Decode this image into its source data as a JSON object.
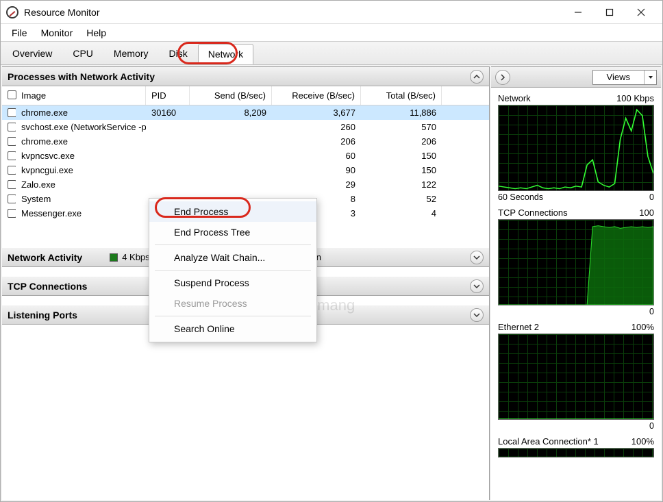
{
  "window": {
    "title": "Resource Monitor"
  },
  "menu": [
    "File",
    "Monitor",
    "Help"
  ],
  "tabs": {
    "items": [
      "Overview",
      "CPU",
      "Memory",
      "Disk",
      "Network"
    ],
    "active_index": 4
  },
  "processes_section": {
    "title": "Processes with Network Activity",
    "columns": [
      "Image",
      "PID",
      "Send (B/sec)",
      "Receive (B/sec)",
      "Total (B/sec)"
    ],
    "rows": [
      {
        "image": "chrome.exe",
        "pid": "30160",
        "send": "8,209",
        "recv": "3,677",
        "total": "11,886",
        "selected": true
      },
      {
        "image": "svchost.exe (NetworkService -p",
        "pid": "",
        "send": "",
        "recv": "260",
        "total": "570",
        "selected": false
      },
      {
        "image": "chrome.exe",
        "pid": "",
        "send": "",
        "recv": "206",
        "total": "206",
        "selected": false
      },
      {
        "image": "kvpncsvc.exe",
        "pid": "",
        "send": "",
        "recv": "60",
        "total": "150",
        "selected": false
      },
      {
        "image": "kvpncgui.exe",
        "pid": "",
        "send": "",
        "recv": "90",
        "total": "150",
        "selected": false
      },
      {
        "image": "Zalo.exe",
        "pid": "",
        "send": "",
        "recv": "29",
        "total": "122",
        "selected": false
      },
      {
        "image": "System",
        "pid": "",
        "send": "",
        "recv": "8",
        "total": "52",
        "selected": false
      },
      {
        "image": "Messenger.exe",
        "pid": "",
        "send": "",
        "recv": "3",
        "total": "4",
        "selected": false
      }
    ]
  },
  "context_menu": {
    "items": [
      {
        "label": "End Process",
        "kind": "item",
        "highlighted": true
      },
      {
        "label": "End Process Tree",
        "kind": "item"
      },
      {
        "kind": "sep"
      },
      {
        "label": "Analyze Wait Chain...",
        "kind": "item"
      },
      {
        "kind": "sep"
      },
      {
        "label": "Suspend Process",
        "kind": "item"
      },
      {
        "label": "Resume Process",
        "kind": "item",
        "disabled": true
      },
      {
        "kind": "sep"
      },
      {
        "label": "Search Online",
        "kind": "item"
      }
    ]
  },
  "collapsed_sections": [
    {
      "title": "Network Activity",
      "chip1_color": "#1c7a1c",
      "chip1_text": "4 Kbps Network I/O",
      "chip2_color": "#2a2aa8",
      "chip2_text": "0% Network Utilization"
    },
    {
      "title": "TCP Connections"
    },
    {
      "title": "Listening Ports"
    }
  ],
  "right_panel": {
    "views_label": "Views",
    "charts": [
      {
        "title": "Network",
        "scale": "100 Kbps",
        "footer_left": "60 Seconds",
        "footer_right": "0",
        "style": "spiky"
      },
      {
        "title": "TCP Connections",
        "scale": "100",
        "footer_left": "",
        "footer_right": "0",
        "style": "plateau"
      },
      {
        "title": "Ethernet 2",
        "scale": "100%",
        "footer_left": "",
        "footer_right": "0",
        "style": "flat"
      },
      {
        "title": "Local Area Connection* 1",
        "scale": "100%",
        "footer_left": "",
        "footer_right": "",
        "style": "flat-partial"
      }
    ]
  },
  "watermark": "Quantrimang",
  "chart_data": [
    {
      "type": "line",
      "title": "Network",
      "ylabel": "Kbps",
      "ylim": [
        0,
        100
      ],
      "xlabel": "60 Seconds",
      "x_range_seconds": 60,
      "values": [
        5,
        4,
        3,
        2,
        3,
        2,
        4,
        6,
        3,
        2,
        3,
        2,
        4,
        3,
        5,
        4,
        30,
        36,
        10,
        6,
        4,
        8,
        60,
        85,
        70,
        95,
        88,
        40,
        20
      ]
    },
    {
      "type": "area",
      "title": "TCP Connections",
      "ylim": [
        0,
        100
      ],
      "x_range_seconds": 60,
      "values": [
        0,
        0,
        0,
        0,
        0,
        0,
        0,
        0,
        0,
        0,
        0,
        0,
        0,
        0,
        0,
        0,
        0,
        92,
        93,
        92,
        91,
        92,
        90,
        91,
        92,
        91,
        92,
        91,
        92
      ]
    },
    {
      "type": "line",
      "title": "Ethernet 2",
      "ylabel": "%",
      "ylim": [
        0,
        100
      ],
      "x_range_seconds": 60,
      "values": [
        0,
        0,
        0,
        0,
        0,
        0,
        0,
        0,
        0,
        0,
        0,
        0,
        0,
        0,
        0,
        0,
        0,
        0,
        0,
        0,
        0,
        0,
        0,
        0,
        0,
        0,
        0,
        0,
        0
      ]
    },
    {
      "type": "line",
      "title": "Local Area Connection* 1",
      "ylabel": "%",
      "ylim": [
        0,
        100
      ],
      "x_range_seconds": 60,
      "values": [
        0,
        0,
        0,
        0,
        0,
        0,
        0,
        0,
        0,
        0,
        0,
        0,
        0,
        0,
        0,
        0,
        0,
        0,
        0,
        0,
        0,
        0,
        0,
        0,
        0,
        0,
        0,
        0,
        0
      ]
    }
  ]
}
